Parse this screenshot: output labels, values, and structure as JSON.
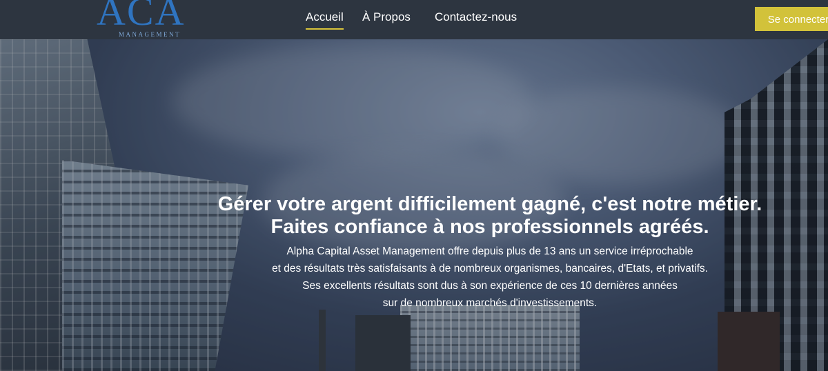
{
  "brand": {
    "logo_text": "ACA",
    "logo_subtext": "MANAGEMENT"
  },
  "nav": {
    "items": [
      {
        "label": "Accueil",
        "active": true
      },
      {
        "label": "À Propos"
      },
      {
        "label": "Contactez-nous"
      }
    ],
    "login_label": "Se connecter"
  },
  "hero": {
    "headline_1": "Gérer votre argent difficilement gagné, c'est notre métier.",
    "headline_2": "Faites confiance à nos professionnels agréés.",
    "paragraph": [
      "Alpha Capital Asset Management offre depuis plus de 13 ans un service irréprochable",
      "et des résultats très satisfaisants à de nombreux organismes, bancaires, d'Etats, et privatifs.",
      "Ses excellents résultats sont dus à son expérience de ces 10 dernières années",
      "sur de nombreux marchés d'investissements."
    ]
  },
  "colors": {
    "accent": "#d2c23a",
    "nav_bg": "#2d3540",
    "logo_blue": "#2f74c0"
  }
}
